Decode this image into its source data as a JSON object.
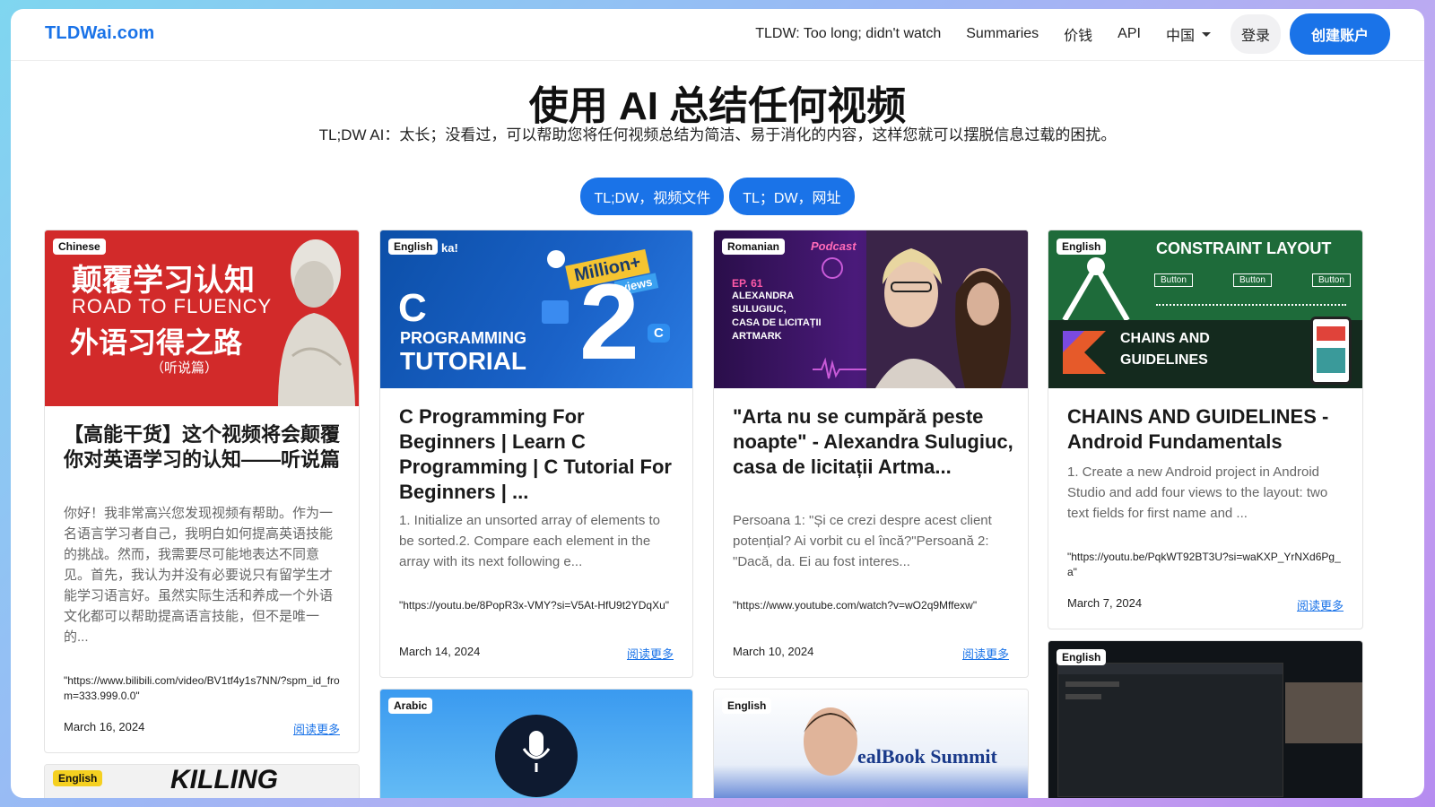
{
  "header": {
    "logo": "TLDWai.com",
    "nav": {
      "tldw": "TLDW: Too long; didn't watch",
      "summaries": "Summaries",
      "pricing": "价钱",
      "api": "API",
      "region": "中国",
      "login": "登录",
      "signup": "创建账户"
    }
  },
  "hero": {
    "title": "使用 AI 总结任何视频",
    "subtitle": "TL;DW AI：太长；没看过，可以帮助您将任何视频总结为简洁、易于消化的内容，这样您就可以摆脱信息过载的困扰。",
    "btn_file": "TL;DW，视频文件",
    "btn_url": "TL；DW，网址"
  },
  "cards": [
    {
      "lang": "Chinese",
      "thumb": {
        "line1": "颠覆学习认知",
        "line2": "ROAD TO FLUENCY",
        "line3": "外语习得之路",
        "line4": "（听说篇）"
      },
      "title": "【高能干货】这个视频将会颠覆你对英语学习的认知——听说篇",
      "desc": "你好！我非常高兴您发现视频有帮助。作为一名语言学习者自己，我明白如何提高英语技能的挑战。然而，我需要尽可能地表达不同意见。首先，我认为并没有必要说只有留学生才能学习语言好。虽然实际生活和养成一个外语文化都可以帮助提高语言技能，但不是唯一的...",
      "url": "\"https://www.bilibili.com/video/BV1tf4y1s7NN/?spm_id_from=333.999.0.0\"",
      "date": "March 16, 2024",
      "more": "阅读更多"
    },
    {
      "lang": "English",
      "thumb": {
        "top": "ka!",
        "c": "C",
        "programming": "PROGRAMMING",
        "tutorial": "TUTORIAL",
        "million": "Million+",
        "views": "views",
        "two": "2",
        "badge": "C"
      },
      "title": "C Programming For Beginners | Learn C Programming | C Tutorial For Beginners | ...",
      "desc": "1. Initialize an unsorted array of elements to be sorted.2. Compare each element in the array with its next following e...",
      "url": "\"https://youtu.be/8PopR3x-VMY?si=V5At-HfU9t2YDqXu\"",
      "date": "March 14, 2024",
      "more": "阅读更多"
    },
    {
      "lang": "Romanian",
      "thumb": {
        "podcast": "Podcast",
        "ep": "EP. 61",
        "names": "ALEXANDRA\nSULUGIUC,\nCASA DE LICITAȚII\nARTMARK"
      },
      "title": "\"Arta nu se cumpără peste noapte\" - Alexandra Sulugiuc, casa de licitații Artma...",
      "desc": "Persoana 1: \"Și ce crezi despre acest client potențial? Ai vorbit cu el încă?\"Persoană 2: \"Dacă, da. Ei au fost interes...",
      "url": "\"https://www.youtube.com/watch?v=wO2q9Mffexw\"",
      "date": "March 10, 2024",
      "more": "阅读更多"
    },
    {
      "lang": "English",
      "thumb": {
        "constraint": "CONSTRAINT LAYOUT",
        "button": "Button",
        "chains": "CHAINS AND",
        "guidelines": "GUIDELINES"
      },
      "title": "CHAINS AND GUIDELINES - Android Fundamentals",
      "desc": "1. Create a new Android project in Android Studio and add four views to the layout: two text fields for first name and ...",
      "url": "\"https://youtu.be/PqkWT92BT3U?si=waKXP_YrNXd6Pg_a\"",
      "date": "March 7, 2024",
      "more": "阅读更多"
    }
  ],
  "row2": [
    {
      "lang": "English",
      "thumb_text": "KILLING"
    },
    {
      "lang": "Arabic"
    },
    {
      "lang": "English",
      "thumb_text": "ealBook Summit"
    },
    {
      "lang": "English"
    }
  ]
}
